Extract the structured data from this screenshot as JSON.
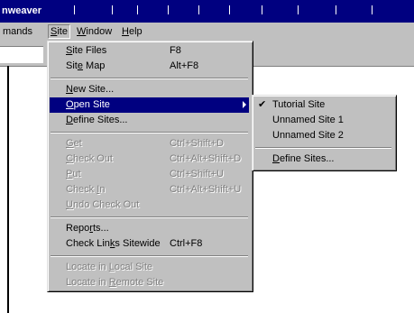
{
  "window": {
    "title": "nweaver"
  },
  "menubar": {
    "items": [
      {
        "label": "mands"
      },
      {
        "label": "Site",
        "mnemonic": "S",
        "rest": "ite"
      },
      {
        "label": "Window",
        "mnemonic": "W",
        "rest": "indow"
      },
      {
        "label": "Help",
        "mnemonic": "H",
        "rest": "elp"
      }
    ]
  },
  "site_menu": {
    "site_files": {
      "pre": "",
      "mn": "S",
      "post": "ite Files",
      "shortcut": "F8"
    },
    "site_map": {
      "pre": "Sit",
      "mn": "e",
      "post": " Map",
      "shortcut": "Alt+F8"
    },
    "new_site": {
      "pre": "",
      "mn": "N",
      "post": "ew Site..."
    },
    "open_site": {
      "pre": "",
      "mn": "O",
      "post": "pen Site"
    },
    "define_sites": {
      "pre": "",
      "mn": "D",
      "post": "efine Sites..."
    },
    "get": {
      "pre": "",
      "mn": "G",
      "post": "et",
      "shortcut": "Ctrl+Shift+D"
    },
    "check_out": {
      "pre": "",
      "mn": "C",
      "post": "heck Out",
      "shortcut": "Ctrl+Alt+Shift+D"
    },
    "put": {
      "pre": "",
      "mn": "P",
      "post": "ut",
      "shortcut": "Ctrl+Shift+U"
    },
    "check_in": {
      "pre": "Check ",
      "mn": "I",
      "post": "n",
      "shortcut": "Ctrl+Alt+Shift+U"
    },
    "undo_check_out": {
      "pre": "",
      "mn": "U",
      "post": "ndo Check Out"
    },
    "reports": {
      "pre": "Repo",
      "mn": "r",
      "post": "ts..."
    },
    "check_links": {
      "pre": "Check Lin",
      "mn": "k",
      "post": "s Sitewide",
      "shortcut": "Ctrl+F8"
    },
    "locate_local": {
      "pre": "Locate in ",
      "mn": "L",
      "post": "ocal Site"
    },
    "locate_remote": {
      "pre": "Locate in ",
      "mn": "R",
      "post": "emote Site"
    }
  },
  "open_site_submenu": {
    "items": [
      {
        "label": "Tutorial Site",
        "checked": true
      },
      {
        "label": "Unnamed Site 1",
        "checked": false
      },
      {
        "label": "Unnamed Site 2",
        "checked": false
      }
    ],
    "define_sites": {
      "pre": "",
      "mn": "D",
      "post": "efine Sites..."
    },
    "check_glyph": "✔"
  },
  "colors": {
    "title_bar": "#000080",
    "menu_bg": "#c0c0c0",
    "highlight": "#000080",
    "disabled_text": "#808080"
  }
}
